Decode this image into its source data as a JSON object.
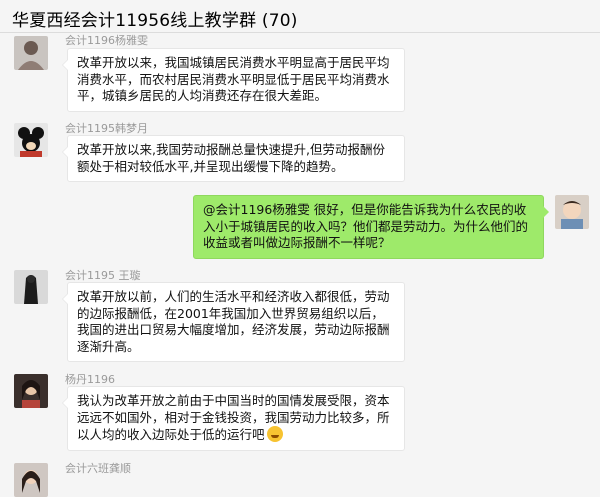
{
  "window": {
    "title": "华夏西经会计11956线上教学群 (70)"
  },
  "messages": [
    {
      "sender": "会计1196杨雅雯",
      "text": "改革开放以来，我国城镇居民消费水平明显高于居民平均消费水平，而农村居民消费水平明显低于居民平均消费水平，城镇乡居民的人均消费还存在很大差距。",
      "direction": "in",
      "avatar_icon": "person-avatar"
    },
    {
      "sender": "会计1195韩梦月",
      "text": "改革开放以来,我国劳动报酬总量快速提升,但劳动报酬份额处于相对较低水平,并呈现出缓慢下降的趋势。",
      "direction": "in",
      "avatar_icon": "mickey-avatar"
    },
    {
      "sender": "",
      "text": "@会计1196杨雅雯 很好，但是你能告诉我为什么农民的收入小于城镇居民的收入吗？他们都是劳动力。为什么他们的收益或者叫做边际报酬不一样呢？",
      "direction": "out",
      "avatar_icon": "baby-avatar"
    },
    {
      "sender": "会计1195 王璇",
      "text": "改革开放以前，人们的生活水平和经济收入都很低，劳动的边际报酬低，在2001年我国加入世界贸易组织以后，我国的进出口贸易大幅度增加，经济发展，劳动边际报酬逐渐升高。",
      "direction": "in",
      "avatar_icon": "dark-figure-avatar"
    },
    {
      "sender": "杨丹1196",
      "text": "我认为改革开放之前由于中国当时的国情发展受限，资本远远不如国外，相对于金钱投资，我国劳动力比较多，所以人均的收入边际处于低的运行吧",
      "emoji": "grin-sweat-emoji",
      "direction": "in",
      "avatar_icon": "woman-avatar"
    },
    {
      "sender": "会计六班龚顺",
      "text": "",
      "direction": "in",
      "avatar_icon": "girl-avatar"
    }
  ],
  "colors": {
    "outgoing_bubble": "#9eea6a",
    "incoming_bubble": "#ffffff",
    "background": "#f5f5f5"
  }
}
